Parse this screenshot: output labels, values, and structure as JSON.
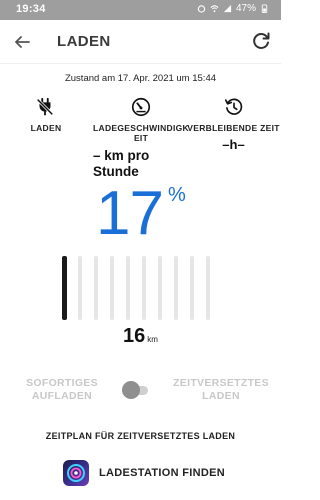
{
  "status_bar": {
    "time": "19:34",
    "battery": "47%"
  },
  "header": {
    "title": "LADEN"
  },
  "timestamp": "Zustand am 17. Apr. 2021 um 15:44",
  "stats": {
    "charging": {
      "label": "LADEN"
    },
    "speed": {
      "label_line1": "LADEGESCHWINDIGK",
      "label_line2": "EIT",
      "value_line1": "– km pro",
      "value_line2": "Stunde"
    },
    "remaining": {
      "label": "VERBLEIBENDE ZEIT",
      "value": "–h–"
    }
  },
  "battery": {
    "percent": "17",
    "percent_symbol": "%",
    "level_fraction": 0.1
  },
  "range": {
    "value": "16",
    "unit": "km"
  },
  "charge_mode": {
    "left_line1": "SOFORTIGES",
    "left_line2": "AUFLADEN",
    "right_line1": "ZEITVERSETZTES",
    "right_line2": "LADEN"
  },
  "schedule_link": "ZEITPLAN FÜR ZEITVERSETZTES LADEN",
  "find_station": {
    "label": "LADESTATION FINDEN"
  },
  "colors": {
    "accent": "#1a6ed8",
    "status_bar": "#9e9e9e",
    "inactive": "#c8c8c8"
  },
  "icons": [
    "back-arrow-icon",
    "refresh-icon",
    "plug-icon",
    "speedometer-icon",
    "clock-icon",
    "ev-app-icon"
  ]
}
